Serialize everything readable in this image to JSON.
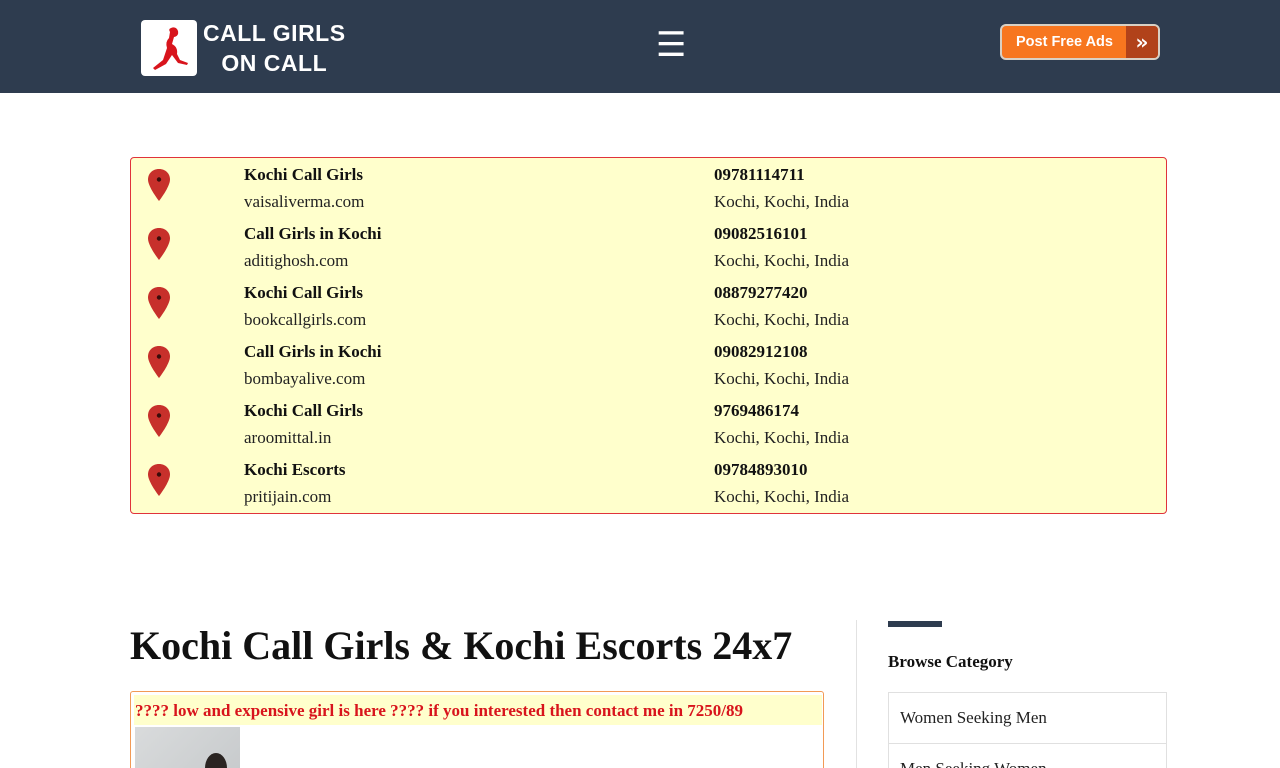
{
  "header": {
    "logo_line1": "CALL GIRLS",
    "logo_line2": "ON CALL",
    "menu_icon": "☰",
    "post_button_label": "Post Free Ads",
    "post_button_arrow": "»",
    "background_color": "#2e3c4f",
    "button_color": "#f7761f"
  },
  "listings": [
    {
      "name": "Kochi Call Girls",
      "site": "vaisaliverma.com",
      "phone": "09781114711",
      "location": "Kochi, Kochi, India"
    },
    {
      "name": "Call Girls in Kochi",
      "site": "aditighosh.com",
      "phone": "09082516101",
      "location": "Kochi, Kochi, India"
    },
    {
      "name": "Kochi Call Girls",
      "site": "bookcallgirls.com",
      "phone": "08879277420",
      "location": "Kochi, Kochi, India"
    },
    {
      "name": "Call Girls in Kochi",
      "site": "bombayalive.com",
      "phone": "09082912108",
      "location": "Kochi, Kochi, India"
    },
    {
      "name": "Kochi Call Girls",
      "site": "aroomittal.in",
      "phone": "9769486174",
      "location": "Kochi, Kochi, India"
    },
    {
      "name": "Kochi Escorts",
      "site": "pritijain.com",
      "phone": "09784893010",
      "location": "Kochi, Kochi, India"
    }
  ],
  "main": {
    "page_title": "Kochi Call Girls & Kochi Escorts 24x7",
    "ad_text": "???? low and expensive girl is here ???? if you interested then contact me in 7250/89"
  },
  "sidebar": {
    "title": "Browse Category",
    "items": [
      "Women Seeking Men",
      "Men Seeking Women"
    ]
  },
  "colors": {
    "listing_bg": "#ffffcc",
    "listing_border": "#e0333b",
    "pin_color": "#c7302b",
    "ad_text_color": "#d8141c"
  }
}
